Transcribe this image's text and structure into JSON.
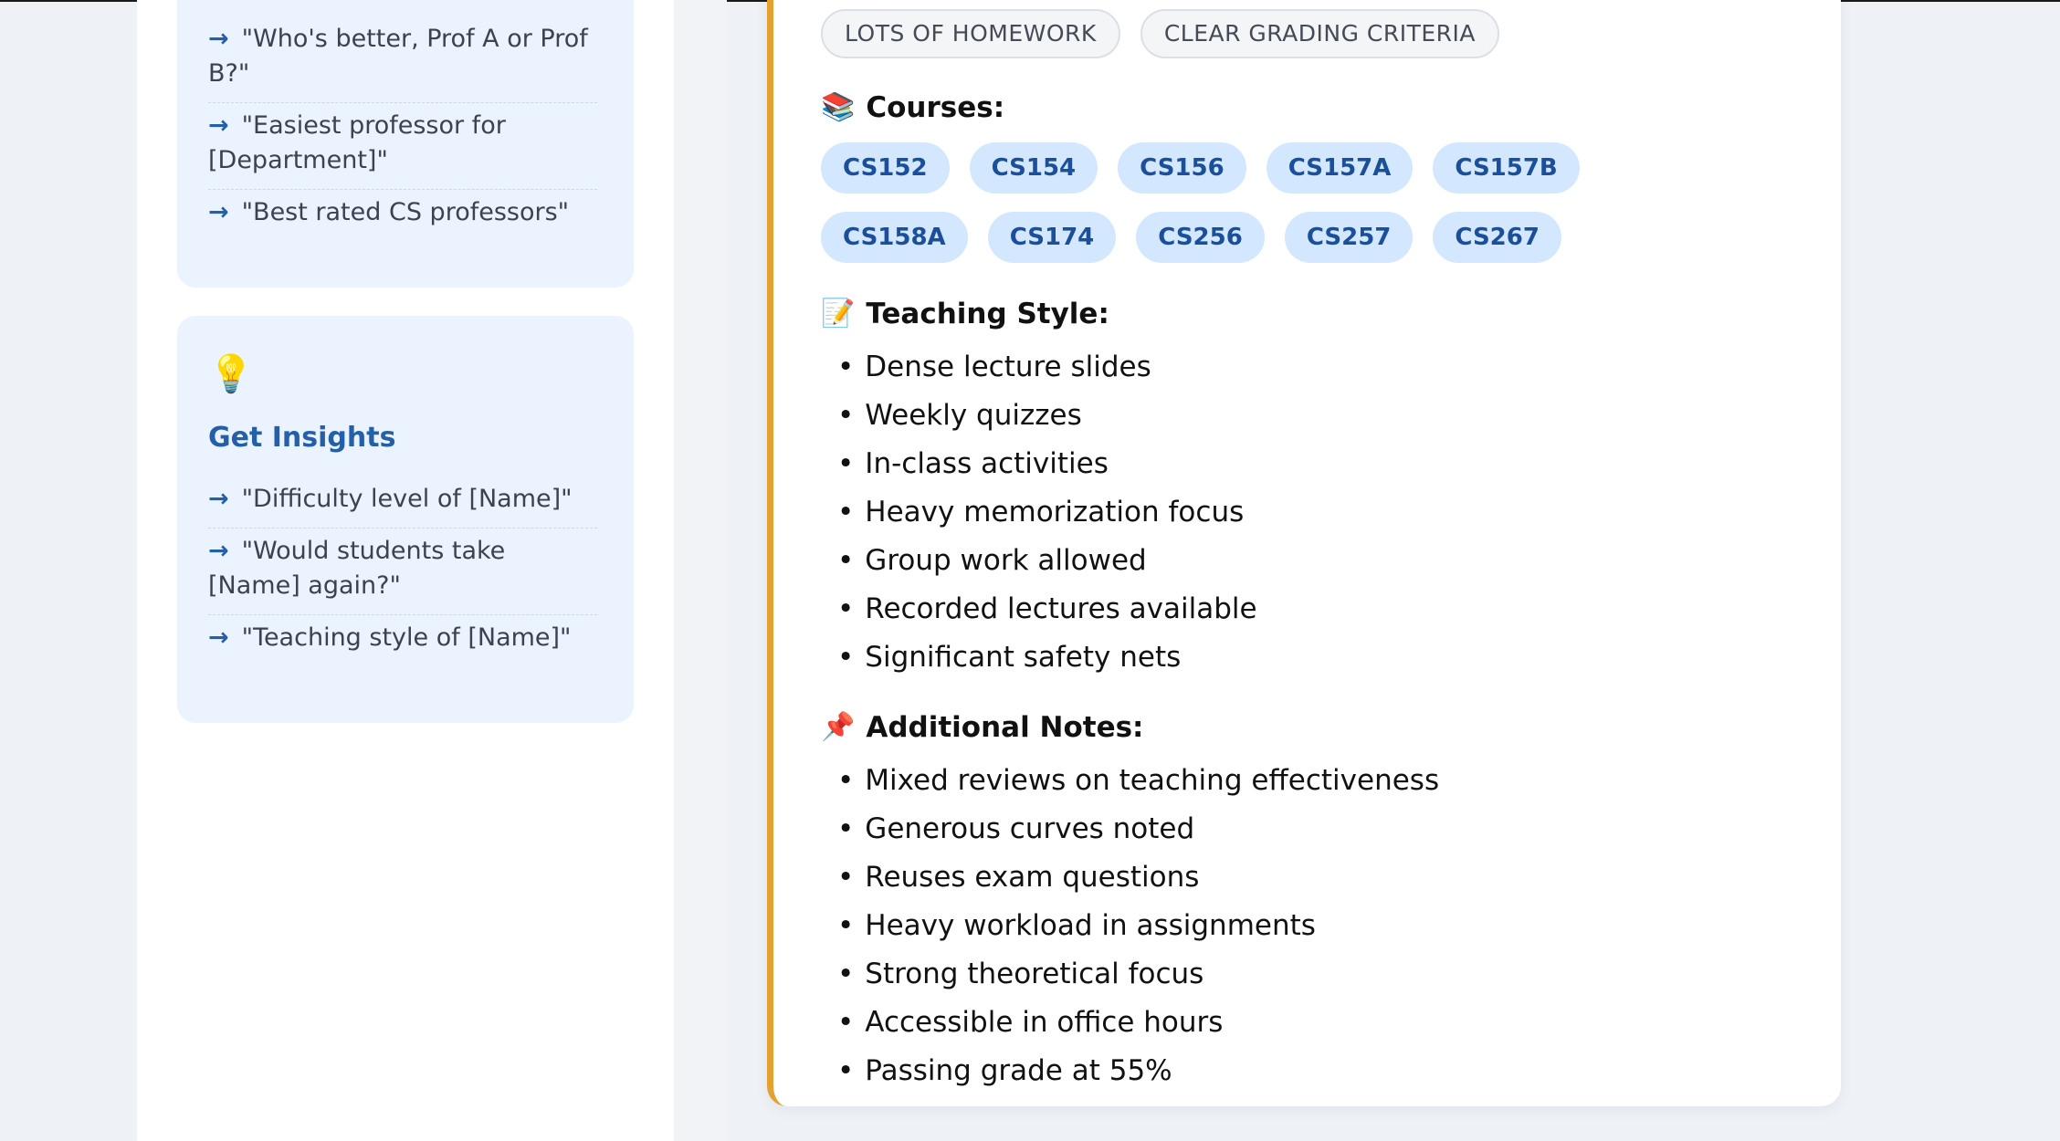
{
  "sidebar": {
    "compare_card": {
      "items": [
        "\"Who's better, Prof A or Prof B?\"",
        "\"Easiest professor for [Department]\"",
        "\"Best rated CS professors\""
      ]
    },
    "insights_card": {
      "icon": "lightbulb-icon",
      "title": "Get Insights",
      "items": [
        "\"Difficulty level of [Name]\"",
        "\"Would students take [Name] again?\"",
        "\"Teaching style of [Name]\""
      ]
    }
  },
  "professor_card": {
    "tags": [
      "LOTS OF HOMEWORK",
      "CLEAR GRADING CRITERIA"
    ],
    "courses_title": "Courses:",
    "courses": [
      "CS152",
      "CS154",
      "CS156",
      "CS157A",
      "CS157B",
      "CS158A",
      "CS174",
      "CS256",
      "CS257",
      "CS267"
    ],
    "teaching_style_title": "Teaching Style:",
    "teaching_style": [
      "Dense lecture slides",
      "Weekly quizzes",
      "In-class activities",
      "Heavy memorization focus",
      "Group work allowed",
      "Recorded lectures available",
      "Significant safety nets"
    ],
    "notes_title": "Additional Notes:",
    "notes": [
      "Mixed reviews on teaching effectiveness",
      "Generous curves noted",
      "Reuses exam questions",
      "Heavy workload in assignments",
      "Strong theoretical focus",
      "Accessible in office hours",
      "Passing grade at 55%"
    ]
  },
  "colors": {
    "accent_border": "#e3a22f",
    "chip_bg": "#d3e7ff",
    "chip_text": "#1c4f99",
    "card_bg": "#eaf3ff",
    "insight_title": "#2460a7"
  }
}
